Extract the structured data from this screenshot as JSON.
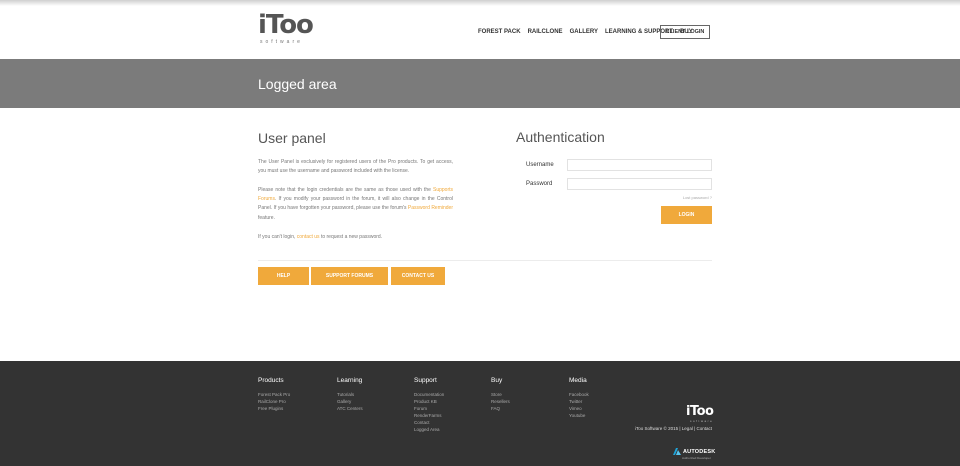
{
  "header": {
    "logo_text": "iToo",
    "logo_sub": "software",
    "nav": [
      "FOREST PACK",
      "RAILCLONE",
      "GALLERY",
      "LEARNING & SUPPORT",
      "BUY"
    ],
    "client_login": "CLIENT LOGIN"
  },
  "banner": {
    "title": "Logged area"
  },
  "user_panel": {
    "title": "User panel",
    "p1": "The User Panel is exclusively for registered users of the Pro products. To get access, you must use the username and password included with the license.",
    "p2_a": "Please note that the login credentials are the same as those used with the ",
    "p2_link1": "Supports Forums",
    "p2_b": ". If you modify your password in the forum, it will also change in the Control Panel. If you have forgotten your password, please use the forum's ",
    "p2_link2": "Password Reminder",
    "p2_c": " feature.",
    "p3_a": "If you can't login, ",
    "p3_link": "contact us",
    "p3_b": " to request a new password.",
    "buttons": {
      "help": "HELP",
      "forums": "SUPPORT FORUMS",
      "contact": "CONTACT US"
    }
  },
  "auth": {
    "title": "Authentication",
    "username_label": "Username",
    "password_label": "Password",
    "username_value": "",
    "password_value": "",
    "lost_password": "Lost password ?",
    "login_button": "LOGIN"
  },
  "footer": {
    "columns": [
      {
        "title": "Products",
        "items": [
          "Forest Pack Pro",
          "RailClone Pro",
          "Free Plugins"
        ]
      },
      {
        "title": "Learning",
        "items": [
          "Tutorials",
          "Gallery",
          "ATC Centers"
        ]
      },
      {
        "title": "Support",
        "items": [
          "Documentation",
          "Product KB",
          "Forum",
          "RenderFarms",
          "Contact",
          "Logged Area"
        ]
      },
      {
        "title": "Buy",
        "items": [
          "Store",
          "Resellers",
          "FAQ"
        ]
      },
      {
        "title": "Media",
        "items": [
          "Facebook",
          "Twitter",
          "Vimeo",
          "Youtube"
        ]
      }
    ],
    "logo_text": "iToo",
    "logo_sub": "software",
    "copyright": "iToo Software © 2015  |  Legal  |  Contact",
    "autodesk": "AUTODESK",
    "autodesk_sub": "Authorized Developer"
  },
  "colors": {
    "accent": "#f0a93b",
    "banner": "#7b7b7b",
    "footer": "#333333"
  }
}
